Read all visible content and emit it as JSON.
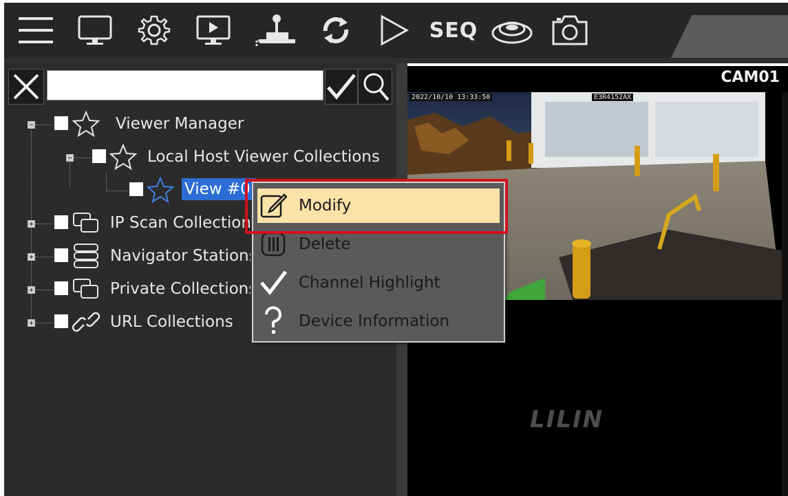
{
  "toolbar": {
    "buttons": [
      {
        "name": "menu-icon"
      },
      {
        "name": "monitor-icon"
      },
      {
        "name": "settings-gear-icon"
      },
      {
        "name": "playback-icon"
      },
      {
        "name": "ptz-joystick-icon"
      },
      {
        "name": "refresh-icon"
      },
      {
        "name": "play-icon"
      },
      {
        "name": "seq-button",
        "label": "SEQ"
      },
      {
        "name": "disk-icon"
      },
      {
        "name": "snapshot-camera-icon"
      }
    ]
  },
  "search": {
    "value": "",
    "placeholder": ""
  },
  "tree": {
    "items": [
      {
        "label": "Viewer Manager",
        "icon": "star-icon"
      },
      {
        "label": "Local Host Viewer Collections",
        "icon": "star-icon"
      },
      {
        "label": "View #0",
        "icon": "star-icon",
        "selected": true
      },
      {
        "label": "IP Scan Collections",
        "icon": "windows-icon"
      },
      {
        "label": "Navigator Stations",
        "icon": "server-stack-icon"
      },
      {
        "label": "Private Collections",
        "icon": "windows-icon"
      },
      {
        "label": "URL Collections",
        "icon": "link-icon"
      }
    ]
  },
  "video": {
    "camera_title": "CAM01",
    "osd_timestamp": "2022/10/10 13:33:50",
    "osd_name": "E3R4152AX",
    "logo_text": "LILIN"
  },
  "context_menu": {
    "items": [
      {
        "label": "Modify",
        "icon": "edit-icon",
        "highlighted": true
      },
      {
        "label": "Delete",
        "icon": "trash-icon"
      },
      {
        "label": "Channel Highlight",
        "icon": "checkmark-icon"
      },
      {
        "label": "Device Information",
        "icon": "question-icon"
      }
    ]
  },
  "colors": {
    "toolbar_bg": "#262626",
    "panel_bg": "#2b2b2b",
    "menu_bg": "#5a5a5a",
    "menu_highlight": "#fbe2a8",
    "annotation_red": "#d0121b",
    "selection_blue": "#2c6dd5"
  }
}
